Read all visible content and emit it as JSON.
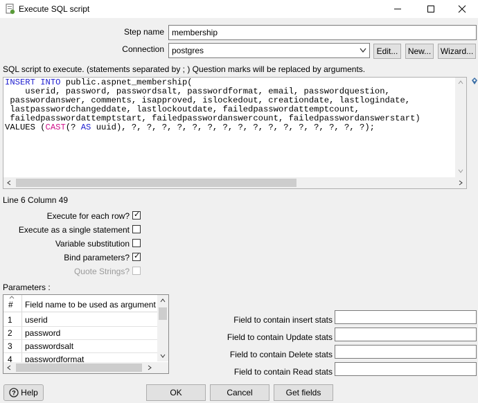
{
  "window": {
    "title": "Execute SQL script"
  },
  "form": {
    "step_name_label": "Step name",
    "step_name_value": "membership",
    "connection_label": "Connection",
    "connection_value": "postgres",
    "edit_button": "Edit...",
    "new_button": "New...",
    "wizard_button": "Wizard..."
  },
  "script": {
    "instruction": "SQL script to execute. (statements separated by ; ) Question marks will be replaced by arguments.",
    "line1_kw": "INSERT INTO",
    "line1_rest": " public.aspnet_membership(",
    "line2": "    userid, password, passwordsalt, passwordformat, email, passwordquestion,",
    "line3": " passwordanswer, comments, isapproved, islockedout, creationdate, lastlogindate,",
    "line4": " lastpasswordchangeddate, lastlockoutdate, failedpasswordattemptcount,",
    "line5": " failedpasswordattemptstart, failedpasswordanswercount, failedpasswordanswerstart)",
    "line6_start": "VALUES (",
    "line6_cast": "CAST",
    "line6_mid": "(? ",
    "line6_as": "AS",
    "line6_rest": " uuid), ?, ?, ?, ?, ?, ?, ?, ?, ?, ?, ?, ?, ?, ?, ?, ?);",
    "cursor_position": "Line 6 Column 49"
  },
  "options": {
    "execute_each_row_label": "Execute for each row?",
    "execute_each_row": true,
    "single_statement_label": "Execute as a single statement",
    "single_statement": false,
    "variable_substitution_label": "Variable substitution",
    "variable_substitution": false,
    "bind_parameters_label": "Bind parameters?",
    "bind_parameters": true,
    "quote_strings_label": "Quote Strings?",
    "quote_strings": false
  },
  "parameters": {
    "label": "Parameters :",
    "col_num": "#",
    "col_field": "Field name to be used as argument",
    "rows": [
      {
        "num": "1",
        "field": "userid"
      },
      {
        "num": "2",
        "field": "password"
      },
      {
        "num": "3",
        "field": "passwordsalt"
      },
      {
        "num": "4",
        "field": "passwordformat"
      }
    ]
  },
  "stats": {
    "insert_label": "Field to contain insert stats",
    "update_label": "Field to contain Update stats",
    "delete_label": "Field to contain Delete stats",
    "read_label": "Field to contain Read stats"
  },
  "footer": {
    "help": "Help",
    "ok": "OK",
    "cancel": "Cancel",
    "get_fields": "Get fields"
  }
}
